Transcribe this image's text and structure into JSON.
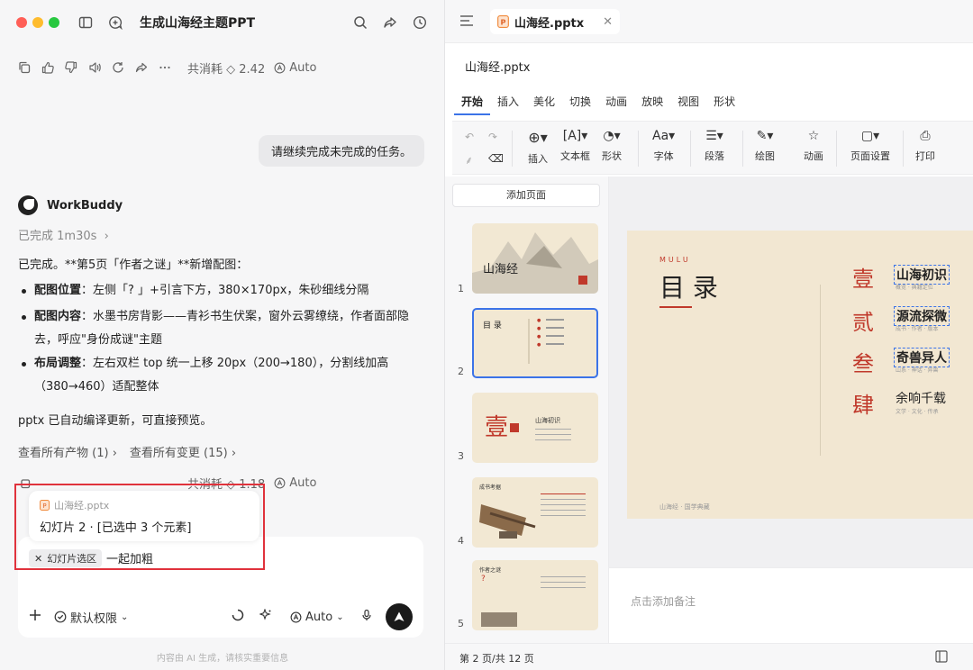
{
  "chat": {
    "title": "生成山海经主题PPT",
    "toolbar_top": {
      "cost_label": "共消耗",
      "cost_value": "2.42",
      "mode": "Auto"
    },
    "user_message": "请继续完成未完成的任务。",
    "bot_name": "WorkBuddy",
    "done_label": "已完成 1m30s",
    "reply_intro": "已完成。**第5页「作者之谜」**新增配图：",
    "bullets": [
      {
        "key": "配图位置",
        "text": "：左侧「? 」+引言下方，380×170px，朱砂细线分隔"
      },
      {
        "key": "配图内容",
        "text": "：水墨书房背影——青衫书生伏案，窗外云雾缭绕，作者面部隐去，呼应\"身份成谜\"主题"
      },
      {
        "key": "布局调整",
        "text": "：左右双栏 top 统一上移 20px（200→180），分割线加高（380→460）适配整体"
      }
    ],
    "reply_footer": "pptx 已自动编译更新，可直接预览。",
    "link_artifacts": "查看所有产物 (1)",
    "link_changes": "查看所有变更 (15)",
    "toolbar_bottom": {
      "cost_label": "共消耗",
      "cost_value": "1.18",
      "mode": "Auto"
    },
    "selection": {
      "file": "山海经.pptx",
      "info": "幻灯片 2 · [已选中 3 个元素]"
    },
    "composer": {
      "chip": "幻灯片选区",
      "text": "一起加粗",
      "permission": "默认权限",
      "mode": "Auto"
    },
    "disclaimer": "内容由 AI 生成，请核实重要信息"
  },
  "ppt": {
    "tab_name": "山海经.pptx",
    "file_name": "山海经.pptx",
    "menu": [
      "开始",
      "插入",
      "美化",
      "切换",
      "动画",
      "放映",
      "视图",
      "形状"
    ],
    "ribbon": {
      "insert": "插入",
      "textbox": "文本框",
      "shape": "形状",
      "font": "字体",
      "paragraph": "段落",
      "draw": "绘图",
      "animation": "动画",
      "page_setup": "页面设置",
      "print": "打印"
    },
    "add_page": "添加页面",
    "thumbs": [
      {
        "num": "1",
        "title": "山海经"
      },
      {
        "num": "2",
        "title": "目 录"
      },
      {
        "num": "3",
        "title": "壹",
        "subtitle": "山海初识"
      },
      {
        "num": "4",
        "title": "成书考据"
      },
      {
        "num": "5",
        "title": "作者之谜"
      }
    ],
    "slide": {
      "kicker": "MULU",
      "title": "目  录",
      "items": [
        {
          "numeral": "壹",
          "title": "山海初识",
          "sub": "概览 · 典籍定位"
        },
        {
          "numeral": "贰",
          "title": "源流探微",
          "sub": "成书 · 作者 · 版本"
        },
        {
          "numeral": "叁",
          "title": "奇兽异人",
          "sub": "山系 · 神话 · 异兽"
        },
        {
          "numeral": "肆",
          "title": "余响千载",
          "sub": "文学 · 文化 · 传承"
        }
      ],
      "footer": "山海经 · 国学典藏"
    },
    "notes_placeholder": "点击添加备注",
    "status": "第 2 页/共 12 页"
  },
  "colors": {
    "accent_red": "#c0392b",
    "selection_blue": "#3b73e8",
    "highlight_red": "#e0323c",
    "slide_bg": "#f2e7d2"
  }
}
